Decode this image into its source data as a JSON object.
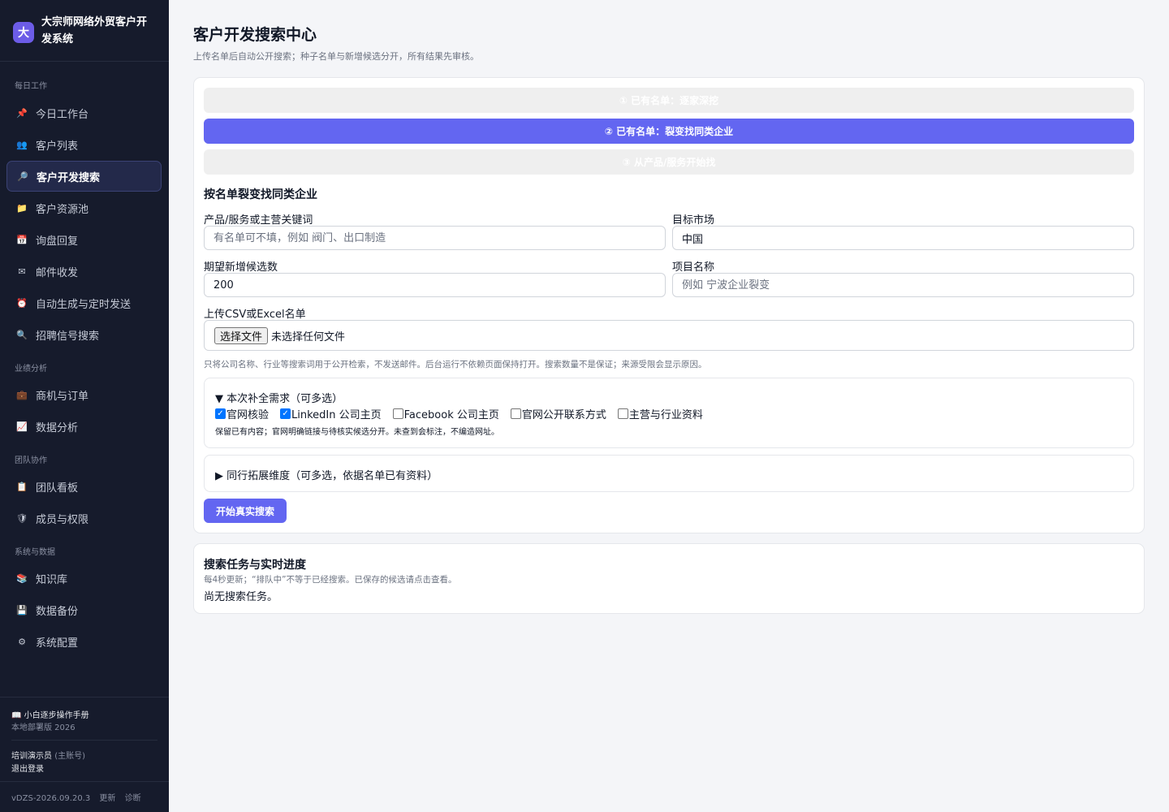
{
  "brand": {
    "logo": "大",
    "name": "大宗师网络外贸客户开发系统"
  },
  "sidebar": {
    "sections": [
      {
        "title": "每日工作",
        "items": [
          {
            "label": "今日工作台",
            "icon": "pin-icon",
            "glyph": "📌",
            "active": false
          },
          {
            "label": "客户列表",
            "icon": "users-icon",
            "glyph": "👥",
            "active": false
          },
          {
            "label": "客户开发搜索",
            "icon": "search-icon",
            "glyph": "🔎",
            "active": true
          },
          {
            "label": "客户资源池",
            "icon": "folder-icon",
            "glyph": "📁",
            "active": false
          },
          {
            "label": "询盘回复",
            "icon": "calendar-icon",
            "glyph": "📅",
            "active": false
          },
          {
            "label": "邮件收发",
            "icon": "mail-icon",
            "glyph": "✉",
            "active": false
          },
          {
            "label": "自动生成与定时发送",
            "icon": "clock-icon",
            "glyph": "⏰",
            "active": false
          },
          {
            "label": "招聘信号搜索",
            "icon": "magnifier-icon",
            "glyph": "🔍",
            "active": false
          }
        ]
      },
      {
        "title": "业绩分析",
        "items": [
          {
            "label": "商机与订单",
            "icon": "briefcase-icon",
            "glyph": "💼",
            "active": false
          },
          {
            "label": "数据分析",
            "icon": "chart-icon",
            "glyph": "📈",
            "active": false
          }
        ]
      },
      {
        "title": "团队协作",
        "items": [
          {
            "label": "团队看板",
            "icon": "clipboard-icon",
            "glyph": "📋",
            "active": false
          },
          {
            "label": "成员与权限",
            "icon": "shield-icon",
            "glyph": "🛡",
            "active": false
          }
        ]
      },
      {
        "title": "系统与数据",
        "items": [
          {
            "label": "知识库",
            "icon": "books-icon",
            "glyph": "📚",
            "active": false
          },
          {
            "label": "数据备份",
            "icon": "disk-icon",
            "glyph": "💾",
            "active": false
          },
          {
            "label": "系统配置",
            "icon": "gear-icon",
            "glyph": "⚙",
            "active": false
          }
        ]
      }
    ],
    "manual": "📖 小白逐步操作手册",
    "edition": "本地部署版 2026",
    "user_name": "培训演示员",
    "user_role": "(主账号)",
    "logout": "退出登录",
    "version": "vDZS-2026.09.20.3",
    "update": "更新",
    "diagnose": "诊断"
  },
  "page": {
    "title": "客户开发搜索中心",
    "subtitle": "上传名单后自动公开搜索；种子名单与新增候选分开，所有结果先审核。"
  },
  "modes": [
    {
      "label": "① 已有名单：逐家深挖",
      "active": false
    },
    {
      "label": "② 已有名单：裂变找同类企业",
      "active": true
    },
    {
      "label": "③ 从产品/服务开始找",
      "active": false
    }
  ],
  "form": {
    "section_title": "按名单裂变找同类企业",
    "keyword_label": "产品/服务或主营关键词",
    "keyword_placeholder": "有名单可不填，例如 阀门、出口制造",
    "market_label": "目标市场",
    "market_value": "中国",
    "count_label": "期望新增候选数",
    "count_value": "200",
    "project_label": "项目名称",
    "project_placeholder": "例如 宁波企业裂变",
    "upload_label": "上传CSV或Excel名单",
    "file_button": "选择文件",
    "file_status": "未选择任何文件",
    "hint": "只将公司名称、行业等搜索词用于公开检索，不发送邮件。后台运行不依赖页面保持打开。搜索数量不是保证；来源受限会显示原因。",
    "enrich_summary": "▼ 本次补全需求（可多选）",
    "enrich_options": [
      {
        "label": "官网核验",
        "checked": true
      },
      {
        "label": "LinkedIn 公司主页",
        "checked": true
      },
      {
        "label": "Facebook 公司主页",
        "checked": false
      },
      {
        "label": "官网公开联系方式",
        "checked": false
      },
      {
        "label": "主营与行业资料",
        "checked": false
      }
    ],
    "enrich_note": "保留已有内容；官网明确链接与待核实候选分开。未查到会标注，不编造网址。",
    "expand_summary": "▶ 同行拓展维度（可多选，依据名单已有资料）",
    "submit": "开始真实搜索"
  },
  "tasks": {
    "title": "搜索任务与实时进度",
    "note": "每4秒更新；“排队中”不等于已经搜索。已保存的候选请点击查看。",
    "empty": "尚无搜索任务。"
  },
  "colors": {
    "accent": "#6366f1",
    "sidebar_bg": "#161b2c",
    "checkbox": "#0075ff"
  }
}
